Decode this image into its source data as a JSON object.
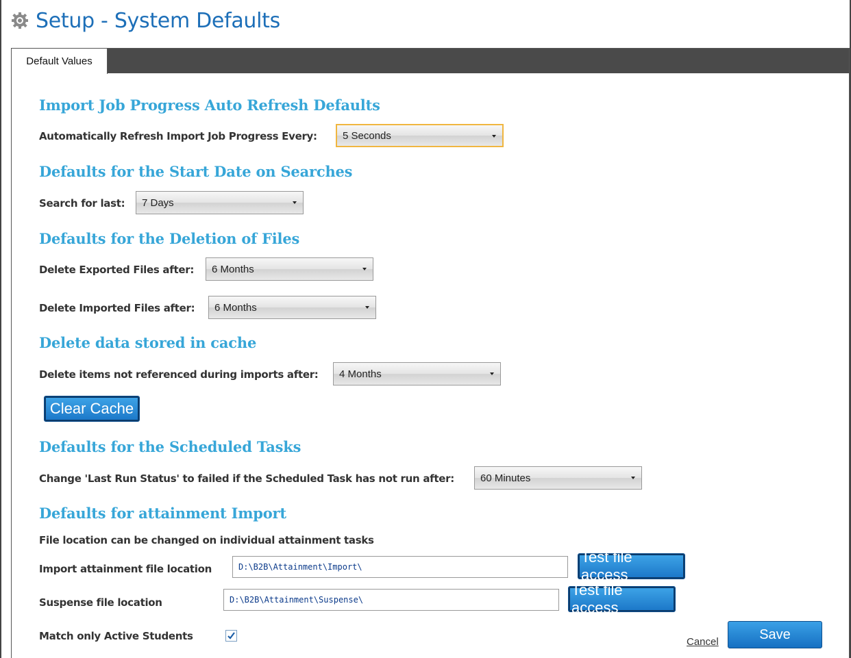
{
  "page": {
    "title": "Setup - System Defaults"
  },
  "tabs": [
    {
      "label": "Default Values"
    }
  ],
  "sections": {
    "import_progress": {
      "heading": "Import Job Progress Auto Refresh Defaults",
      "label": "Automatically Refresh Import Job Progress Every:",
      "value": "5 Seconds"
    },
    "search_start": {
      "heading": "Defaults for the Start Date on Searches",
      "label": "Search for last:",
      "value": "7 Days"
    },
    "deletion": {
      "heading": "Defaults for the Deletion of Files",
      "exported_label": "Delete Exported Files after:",
      "exported_value": "6 Months",
      "imported_label": "Delete Imported Files after:",
      "imported_value": "6 Months"
    },
    "cache": {
      "heading": "Delete data stored in cache",
      "label": "Delete items not referenced during imports after:",
      "value": "4 Months",
      "clear_button": "Clear Cache"
    },
    "scheduled": {
      "heading": "Defaults for the Scheduled Tasks",
      "label": "Change 'Last Run Status' to failed if the Scheduled Task has not run after:",
      "value": "60 Minutes"
    },
    "attainment": {
      "heading": "Defaults for attainment Import",
      "note": "File location can be changed on individual attainment tasks",
      "import_label": "Import attainment file location",
      "import_value": "D:\\B2B\\Attainment\\Import\\",
      "import_test_button": "Test file access",
      "suspense_label": "Suspense file location",
      "suspense_value": "D:\\B2B\\Attainment\\Suspense\\",
      "suspense_test_button": "Test file access",
      "match_label": "Match only Active Students",
      "match_checked": true
    }
  },
  "footer": {
    "cancel": "Cancel",
    "save": "Save"
  },
  "colors": {
    "accent": "#37a6d8",
    "title": "#1d6fb8",
    "button": "#1a76c7",
    "focus": "#f0b640"
  }
}
